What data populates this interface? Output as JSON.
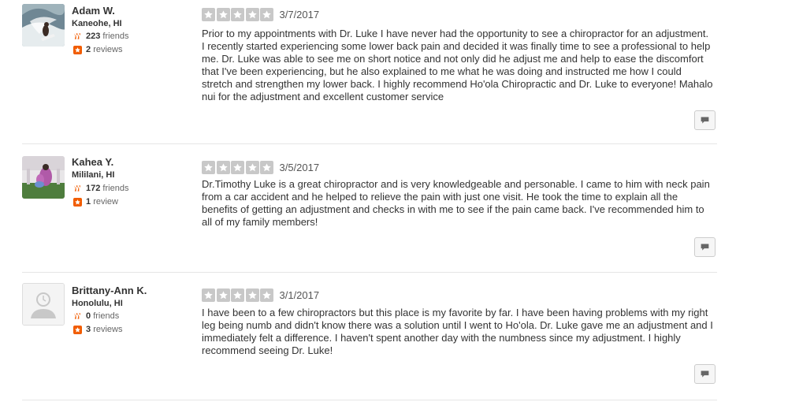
{
  "reviews": [
    {
      "name": "Adam W.",
      "location": "Kaneohe, HI",
      "friends_count": "223",
      "friends_label": "friends",
      "reviews_count": "2",
      "reviews_label": "reviews",
      "rating": 5,
      "date": "3/7/2017",
      "text": "Prior to my appointments with Dr. Luke I have never had the opportunity to see a chiropractor for an adjustment. I recently started experiencing some lower back pain and decided it was finally time to see a professional to help me. Dr. Luke was able to see me on short notice and not only did he adjust me and help to ease the discomfort that I've been experiencing, but he also explained to me what he was doing and instructed me how I could stretch and strengthen my lower back. I highly recommend Ho'ola Chiropractic and Dr. Luke to everyone! Mahalo nui for the adjustment and excellent customer service",
      "avatar": "surfer-photo"
    },
    {
      "name": "Kahea Y.",
      "location": "Mililani, HI",
      "friends_count": "172",
      "friends_label": "friends",
      "reviews_count": "1",
      "reviews_label": "review",
      "rating": 5,
      "date": "3/5/2017",
      "text": "Dr.Timothy Luke is a great chiropractor and is very knowledgeable and personable. I came to him with neck pain from a car accident and he helped to relieve the pain with just one visit. He took the time to explain all the benefits of getting an adjustment and checks in with me to see if the pain came back. I've recommended him to all of my family members!",
      "avatar": "garden-photo"
    },
    {
      "name": "Brittany-Ann K.",
      "location": "Honolulu, HI",
      "friends_count": "0",
      "friends_label": "friends",
      "reviews_count": "3",
      "reviews_label": "reviews",
      "rating": 5,
      "date": "3/1/2017",
      "text": "I have been to a few chiropractors but this place is my favorite by far.  I have been having problems with my right leg being numb and didn't know there was a solution until I went to Ho'ola.  Dr. Luke gave me an adjustment and I immediately felt a difference.  I haven't spent another day with the numbness since my adjustment.  I highly recommend seeing Dr. Luke!",
      "avatar": "default-avatar"
    }
  ],
  "colors": {
    "star_empty": "#c8c8c8",
    "reviews_icon": "#f15c00",
    "friends_icon": "#f15c00"
  }
}
